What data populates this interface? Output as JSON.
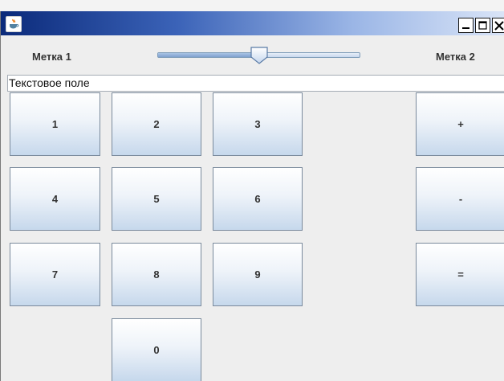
{
  "window": {
    "icon": "java-coffee-cup-icon",
    "controls": [
      {
        "name": "minimize-button",
        "icon": "minimize-icon"
      },
      {
        "name": "maximize-button",
        "icon": "maximize-icon"
      },
      {
        "name": "close-button",
        "icon": "close-icon"
      }
    ]
  },
  "label1": "Метка 1",
  "label2": "Метка 2",
  "slider": {
    "value": 0.5
  },
  "text_field": {
    "value": "Текстовое поле"
  },
  "digits": [
    "1",
    "2",
    "3",
    "4",
    "5",
    "6",
    "7",
    "8",
    "9",
    "0"
  ],
  "ops": [
    "+",
    "-",
    "="
  ],
  "colors": {
    "title_start": "#0b2a7a",
    "title_end": "#d9e4f7",
    "button_top": "#ffffff",
    "button_bottom": "#c6d8ec",
    "button_border": "#7a8a9c"
  }
}
